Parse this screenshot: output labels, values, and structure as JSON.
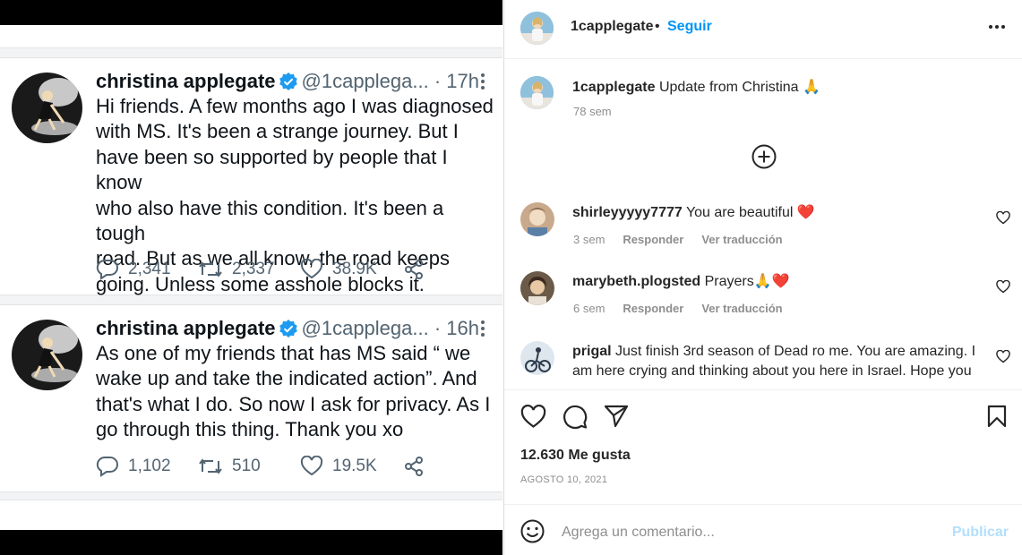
{
  "tweets": [
    {
      "name": "christina applegate",
      "handle": "@1capplega...",
      "time": "· 17h",
      "lines": [
        "Hi friends. A few months ago I was diagnosed",
        "with MS. It's been a strange journey. But I",
        "have been so supported by people that I know",
        "who also have this condition. It's been a tough",
        "road. But as we all know, the road keeps",
        "going. Unless some asshole blocks it."
      ],
      "replies": "2,341",
      "retweets": "2,337",
      "likes": "38.9K"
    },
    {
      "name": "christina applegate",
      "handle": "@1capplega...",
      "time": "· 16h",
      "lines": [
        "As one of my friends that has MS said “ we",
        "wake up and take the indicated action”. And",
        "that's what I do. So now I ask for privacy. As I",
        "go through this thing.  Thank you xo"
      ],
      "replies": "1,102",
      "retweets": "510",
      "likes": "19.5K"
    }
  ],
  "instagram": {
    "header": {
      "username": "1capplegate",
      "dot": "•",
      "follow_label": "Seguir"
    },
    "caption": {
      "username": "1capplegate",
      "text": "Update from Christina 🙏",
      "time": "78 sem"
    },
    "comments": [
      {
        "username": "shirleyyyyy7777",
        "text": "You are beautiful ❤️",
        "time": "3 sem",
        "reply_label": "Responder",
        "translate_label": "Ver traducción"
      },
      {
        "username": "marybeth.plogsted",
        "text": "Prayers🙏❤️",
        "time": "6 sem",
        "reply_label": "Responder",
        "translate_label": "Ver traducción"
      },
      {
        "username": "prigal",
        "text": "Just finish 3rd season of Dead ro me. You are amazing. I am here crying and thinking about you here in Israel. Hope you"
      }
    ],
    "likes_text": "12.630 Me gusta",
    "date": "AGOSTO 10, 2021",
    "comment_placeholder": "Agrega un comentario...",
    "publish_label": "Publicar"
  },
  "colors": {
    "twitter_blue": "#1d9bf0",
    "ig_blue": "#0095f6",
    "ig_publish_disabled": "#b2dffc",
    "heart_red": "#ed4956"
  }
}
